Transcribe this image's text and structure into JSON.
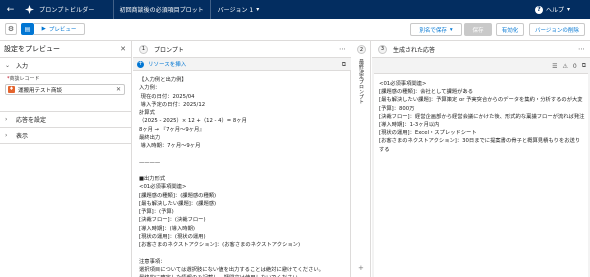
{
  "topbar": {
    "back_icon": "back-arrow-icon",
    "app_name": "プロンプトビルダー",
    "prompt_name": "初回商談後の必須項目プロット",
    "version_label": "バージョン 1",
    "help_label": "ヘルプ",
    "brand_color": "#032d60"
  },
  "toolbar": {
    "preview_label": "プレビュー",
    "save_as_label": "別名で保存",
    "save_label": "保存",
    "activate_label": "有効化",
    "delete_version_label": "バージョンの削除",
    "accent_color": "#0176d3"
  },
  "left_panel": {
    "title": "設定をプレビュー",
    "input_section": "入力",
    "field_label": "商談レコード",
    "record_value": "運搬用テスト商談",
    "response_settings": "応答を設定",
    "display_section": "表示"
  },
  "prompt_column": {
    "step": "1",
    "title": "プロンプト",
    "insert_resource": "リソースを挿入",
    "text": "【入力例と出力例】\n入力例：\n 現在の日付：2025/04\n 導入予定の日付：2025/12\n計算式\n（2025 - 2025）× 12 +（12 - 4）= 8ヶ月\n8ヶ月 → 『7ヶ月〜9ヶ月』\n最終出力\n 導入時期：7ヶ月〜9ヶ月\n\n————\n\n■出力形式\n<01必須事項関連>\n[課題感の種類]：(課題感の種類)\n[最も解決したい課題]：(課題感)\n[予算]：(予算)\n[決裁フロー]：(決裁フロー)\n[導入時期]：(導入時期)\n[現状の運用]：(現状の運用)\n[お客さまのネクストアクション]：(お客さまのネクストアクション)\n\n注意事項：\n選択項目については選択肢にない値を出力することは絶対に避けてください。\n最終的に確定した情報のみ記載し、疑問文は使用しないでください。"
  },
  "vertical_column": {
    "step": "2",
    "label": "最終決定プロンプト"
  },
  "response_column": {
    "step": "3",
    "title": "生成された応答",
    "warning_count": "0",
    "text": "<01必須事項関連>\n[課題感の種類]：会社として課題がある\n[最も解決したい課題]：予算策定 or 予実突合からのデータを集約・分析するのが大変\n[予算]：800万\n[決裁フロー]：経営企画部から経営会議にかけた後、形式的な稟議フローが流れば発注\n[導入時期]：1-3ヶ月以内\n[現状の運用]：Excel・スプレッドシート\n[お客さまのネクストアクション]：30日までに提案書の骨子と概算見積もりをお送りする"
  }
}
